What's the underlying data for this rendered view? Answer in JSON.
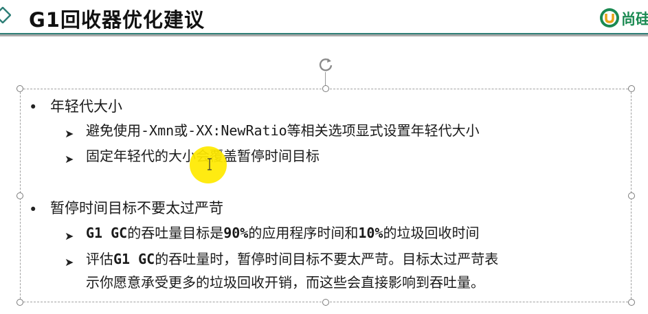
{
  "slide": {
    "title": "G1回收器优化建议",
    "logo_text": "尚硅"
  },
  "content": {
    "sections": [
      {
        "bullet": "年轻代大小",
        "sub": [
          {
            "parts": [
              "避免使用",
              "-Xmn",
              "或",
              "-XX:NewRatio",
              "等相关选项显式设置年轻代大小"
            ]
          },
          {
            "parts": [
              "固定年轻代的大小会覆盖暂停时间目标"
            ]
          }
        ]
      },
      {
        "bullet": "暂停时间目标不要太过严苛",
        "sub": [
          {
            "parts": [
              "G1 GC",
              "的吞吐量目标是",
              "90%",
              "的应用程序时间和",
              "10%",
              "的垃圾回收时间"
            ]
          },
          {
            "parts": [
              "评估",
              "G1 GC",
              "的吞吐量时，暂停时间目标不要太严苛。目标太过严苛表"
            ],
            "cont": "示你愿意承受更多的垃圾回收开销，而这些会直接影响到吞吐量。"
          }
        ]
      }
    ]
  },
  "colors": {
    "header_line": "#2f7f77",
    "logo_green": "#1b8a52",
    "pointer_highlight": "#ffea00"
  }
}
